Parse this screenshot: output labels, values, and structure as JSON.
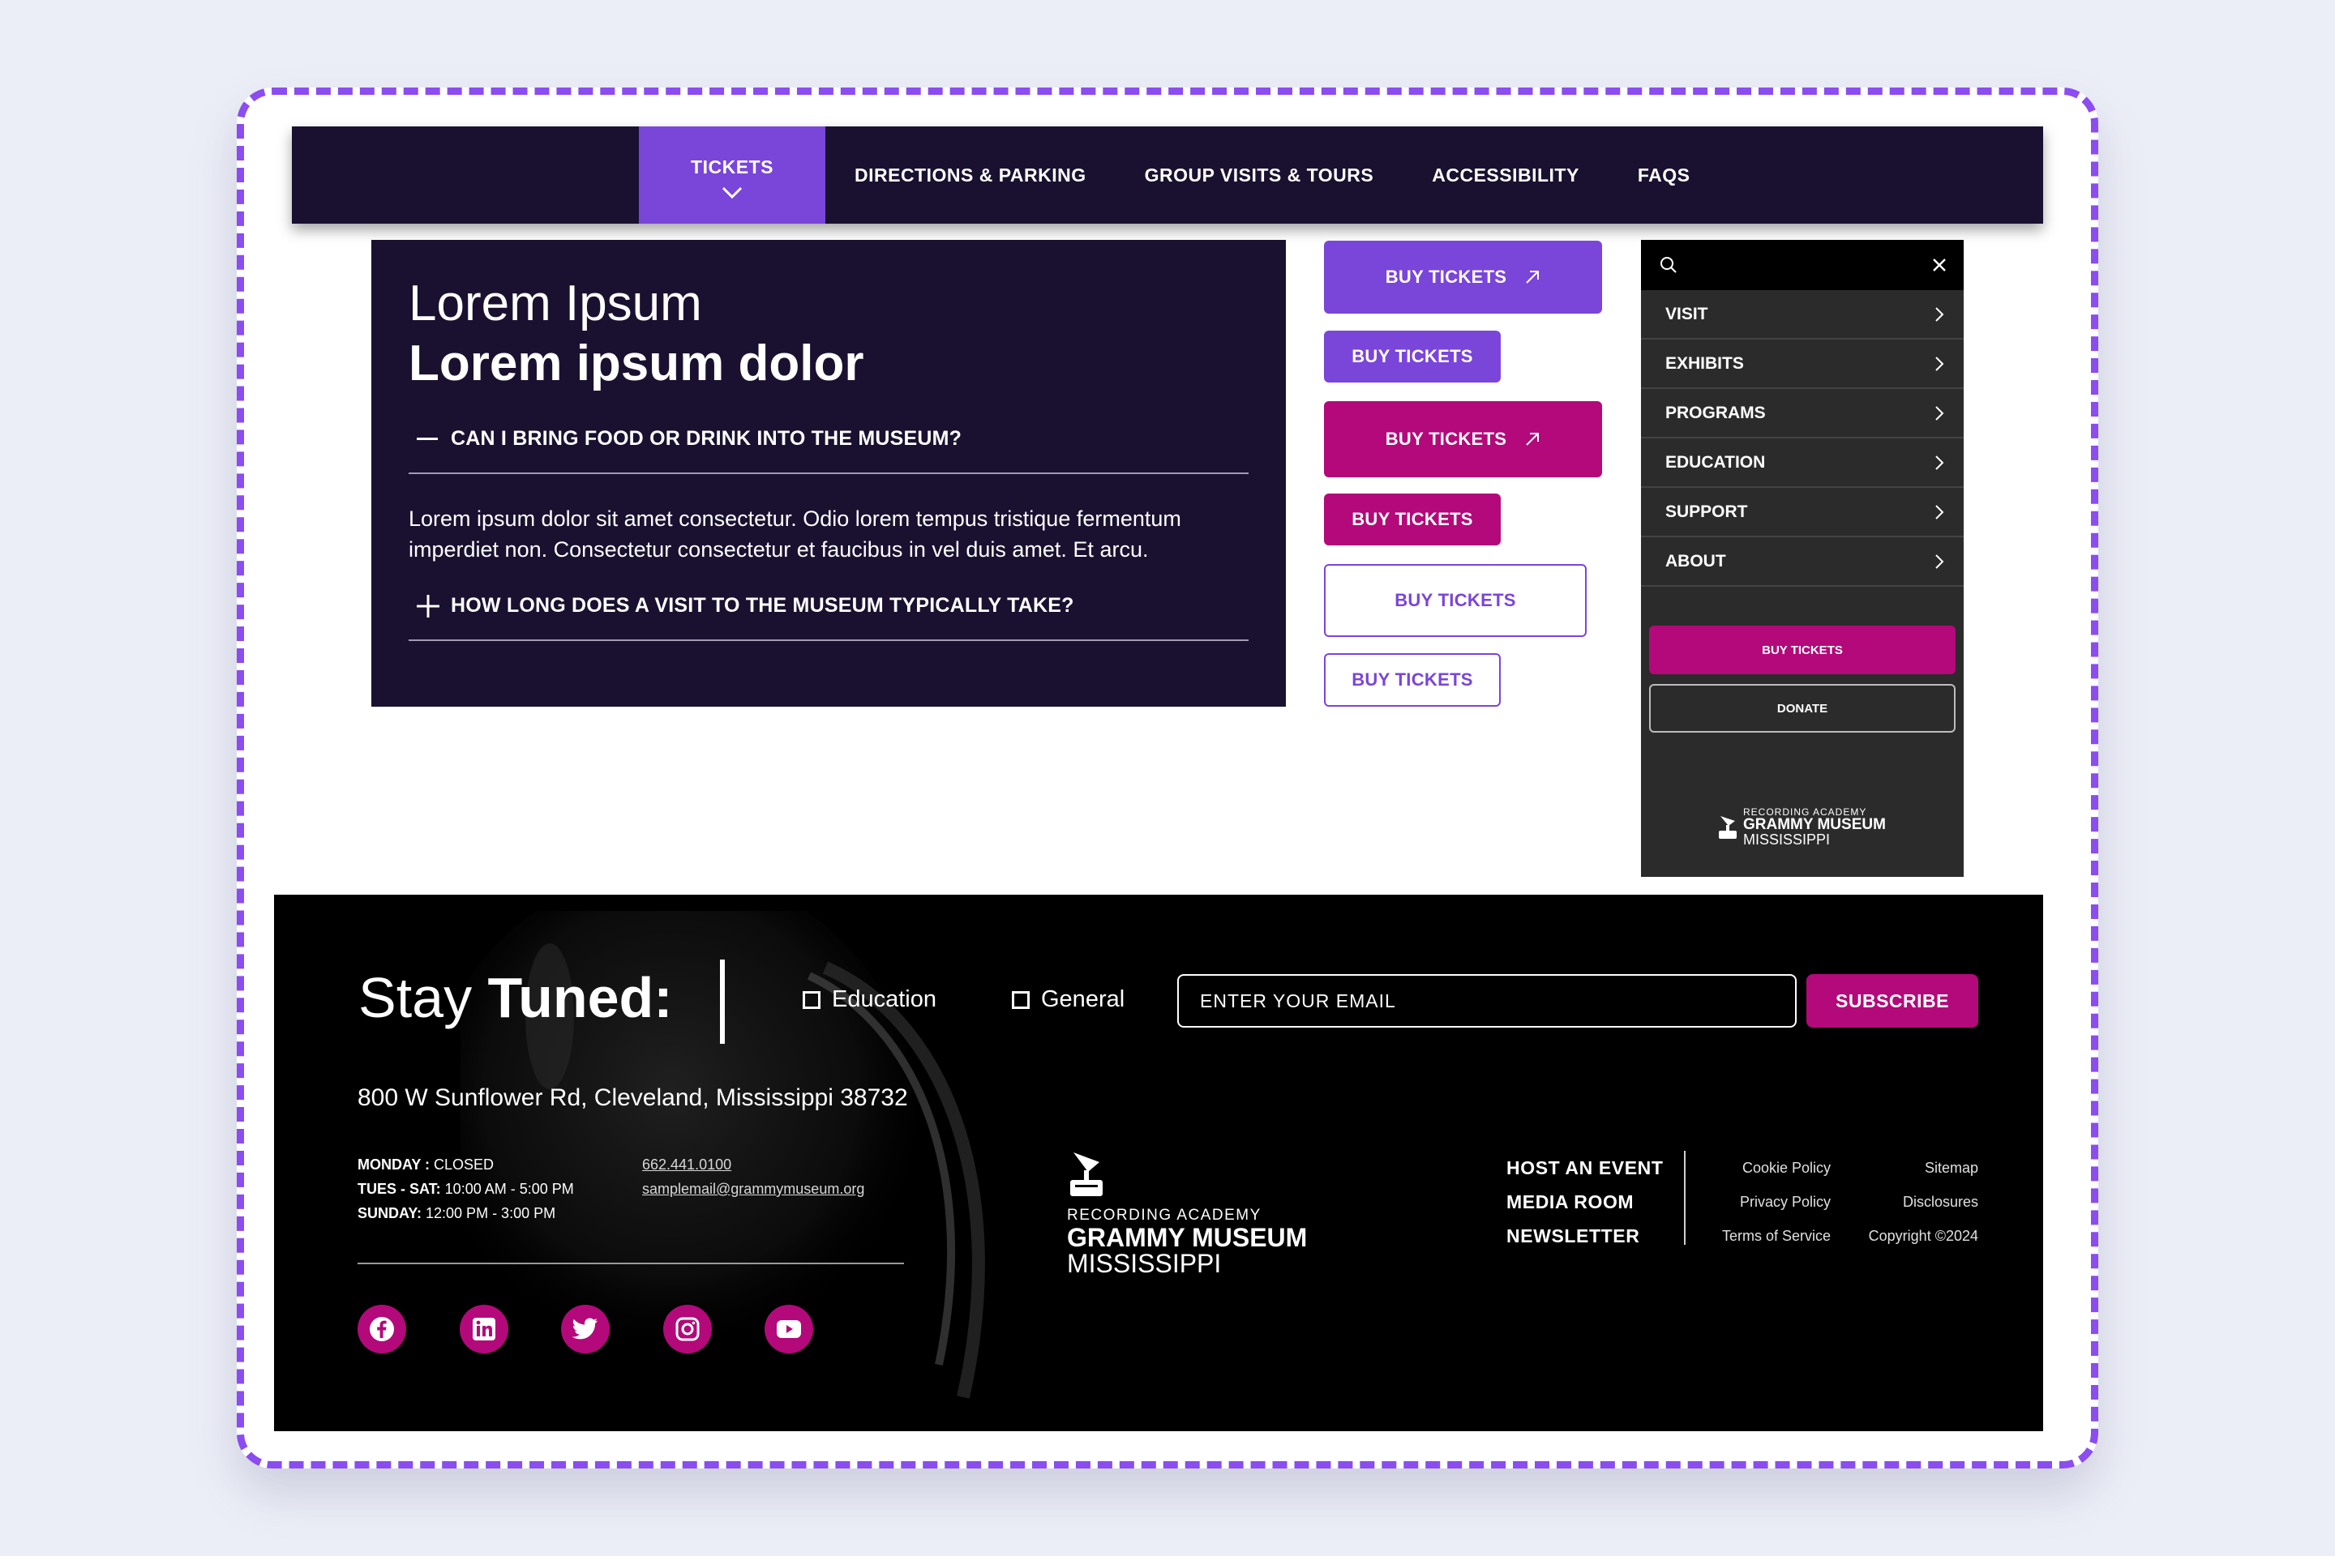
{
  "nav": {
    "items": [
      "TICKETS",
      "DIRECTIONS & PARKING",
      "GROUP VISITS & TOURS",
      "ACCESSIBILITY",
      "FAQS"
    ],
    "active": "TICKETS"
  },
  "faq": {
    "title_light": "Lorem Ipsum",
    "title_bold": "Lorem ipsum dolor",
    "questions": [
      {
        "text": "CAN I BRING FOOD OR DRINK INTO THE MUSEUM?",
        "expanded": true,
        "answer": "Lorem ipsum dolor sit amet consectetur. Odio lorem tempus tristique fermentum imperdiet non. Consectetur consectetur et faucibus in vel duis amet. Et arcu."
      },
      {
        "text": "HOW LONG DOES A VISIT TO THE MUSEUM TYPICALLY TAKE?",
        "expanded": false
      }
    ]
  },
  "buttons": {
    "label": "BUY TICKETS",
    "variants": [
      "purple-large-arrow",
      "purple-small",
      "magenta-large-arrow",
      "magenta-small",
      "outline-large",
      "outline-small"
    ]
  },
  "mobile_menu": {
    "items": [
      "VISIT",
      "EXHIBITS",
      "PROGRAMS",
      "EDUCATION",
      "SUPPORT",
      "ABOUT"
    ],
    "buy_label": "BUY TICKETS",
    "donate_label": "DONATE",
    "logo": {
      "line1": "RECORDING ACADEMY",
      "line2": "GRAMMY MUSEUM",
      "line3": "MISSISSIPPI"
    }
  },
  "footer": {
    "stay": "Stay",
    "tuned": "Tuned:",
    "checkboxes": [
      "Education",
      "General"
    ],
    "email_placeholder": "ENTER YOUR EMAIL",
    "subscribe_label": "SUBSCRIBE",
    "address": "800 W Sunflower Rd, Cleveland, Mississippi 38732",
    "hours": [
      {
        "day": "MONDAY :",
        "time": " CLOSED"
      },
      {
        "day": "TUES - SAT:",
        "time": " 10:00 AM - 5:00 PM"
      },
      {
        "day": "SUNDAY:",
        "time": " 12:00 PM - 3:00 PM"
      }
    ],
    "phone": "662.441.0100",
    "email": "samplemail@grammymuseum.org",
    "social": [
      "facebook-icon",
      "linkedin-icon",
      "twitter-icon",
      "instagram-icon",
      "youtube-icon"
    ],
    "logo": {
      "line1": "RECORDING ACADEMY",
      "line2": "GRAMMY MUSEUM",
      "line3": "MISSISSIPPI"
    },
    "links": [
      "HOST AN EVENT",
      "MEDIA ROOM",
      "NEWSLETTER"
    ],
    "legal_left": [
      "Cookie Policy",
      "Privacy Policy",
      "Terms of Service"
    ],
    "legal_right": [
      "Sitemap",
      "Disclosures",
      "Copyright ©2024"
    ]
  },
  "colors": {
    "purple": "#7a45d9",
    "magenta": "#b3097a",
    "navy": "#1a1130",
    "dashed_border": "#8b4cf0"
  }
}
